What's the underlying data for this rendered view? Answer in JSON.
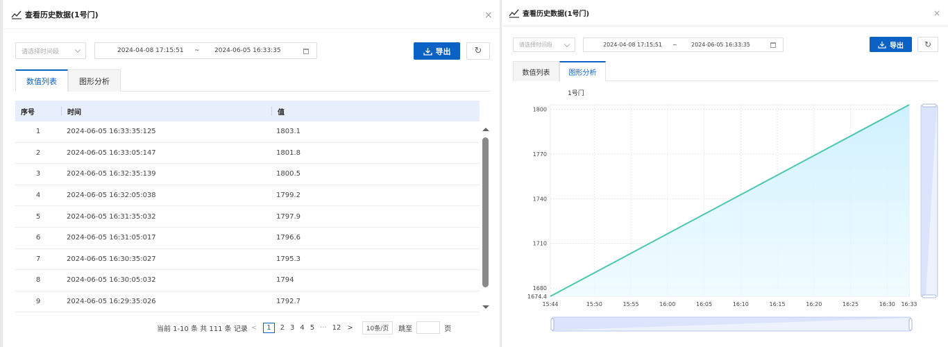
{
  "dialog": {
    "title": "查看历史数据(1号门)",
    "time_select_placeholder": "请选择时间段",
    "start_time": "2024-04-08 17:15:51",
    "range_sep": "~",
    "end_time": "2024-06-05 16:33:35",
    "export_label": "导出",
    "close": "×",
    "refresh": "↻"
  },
  "tabs": {
    "list": "数值列表",
    "chart": "图形分析"
  },
  "table": {
    "headers": {
      "index": "序号",
      "time": "时间",
      "value": "值"
    },
    "rows": [
      {
        "index": "1",
        "time": "2024-06-05 16:33:35:125",
        "value": "1803.1"
      },
      {
        "index": "2",
        "time": "2024-06-05 16:33:05:147",
        "value": "1801.8"
      },
      {
        "index": "3",
        "time": "2024-06-05 16:32:35:139",
        "value": "1800.5"
      },
      {
        "index": "4",
        "time": "2024-06-05 16:32:05:038",
        "value": "1799.2"
      },
      {
        "index": "5",
        "time": "2024-06-05 16:31:35:032",
        "value": "1797.9"
      },
      {
        "index": "6",
        "time": "2024-06-05 16:31:05:017",
        "value": "1796.6"
      },
      {
        "index": "7",
        "time": "2024-06-05 16:30:35:027",
        "value": "1795.3"
      },
      {
        "index": "8",
        "time": "2024-06-05 16:30:05:032",
        "value": "1794"
      },
      {
        "index": "9",
        "time": "2024-06-05 16:29:35:026",
        "value": "1792.7"
      }
    ]
  },
  "pagination": {
    "summary": "当前 1-10 条 共 111 条 记录",
    "prev": "<",
    "pages": [
      "1",
      "2",
      "3",
      "4",
      "5"
    ],
    "ellipsis": "···",
    "last_page": "12",
    "next": ">",
    "page_size": "10条/页",
    "jump_label": "跳至",
    "page_suffix": "页"
  },
  "colors": {
    "accent": "#0a62c4",
    "line": "#4cc7ac",
    "area": "#d9f4fd"
  },
  "chart_data": {
    "type": "area",
    "series": [
      {
        "name": "1号门",
        "x": [
          "15:44",
          "16:33"
        ],
        "y": [
          1674.4,
          1803.1
        ]
      }
    ],
    "x_ticks": [
      "15:44",
      "15:50",
      "15:55",
      "16:00",
      "16:05",
      "16:10",
      "16:15",
      "16:20",
      "16:25",
      "16:30",
      "16:33"
    ],
    "y_ticks": [
      "1674.4",
      "1680",
      "1710",
      "1740",
      "1770",
      "1800"
    ],
    "ylim": [
      1674.4,
      1803.1
    ],
    "grid": true,
    "legend": "top-left"
  }
}
